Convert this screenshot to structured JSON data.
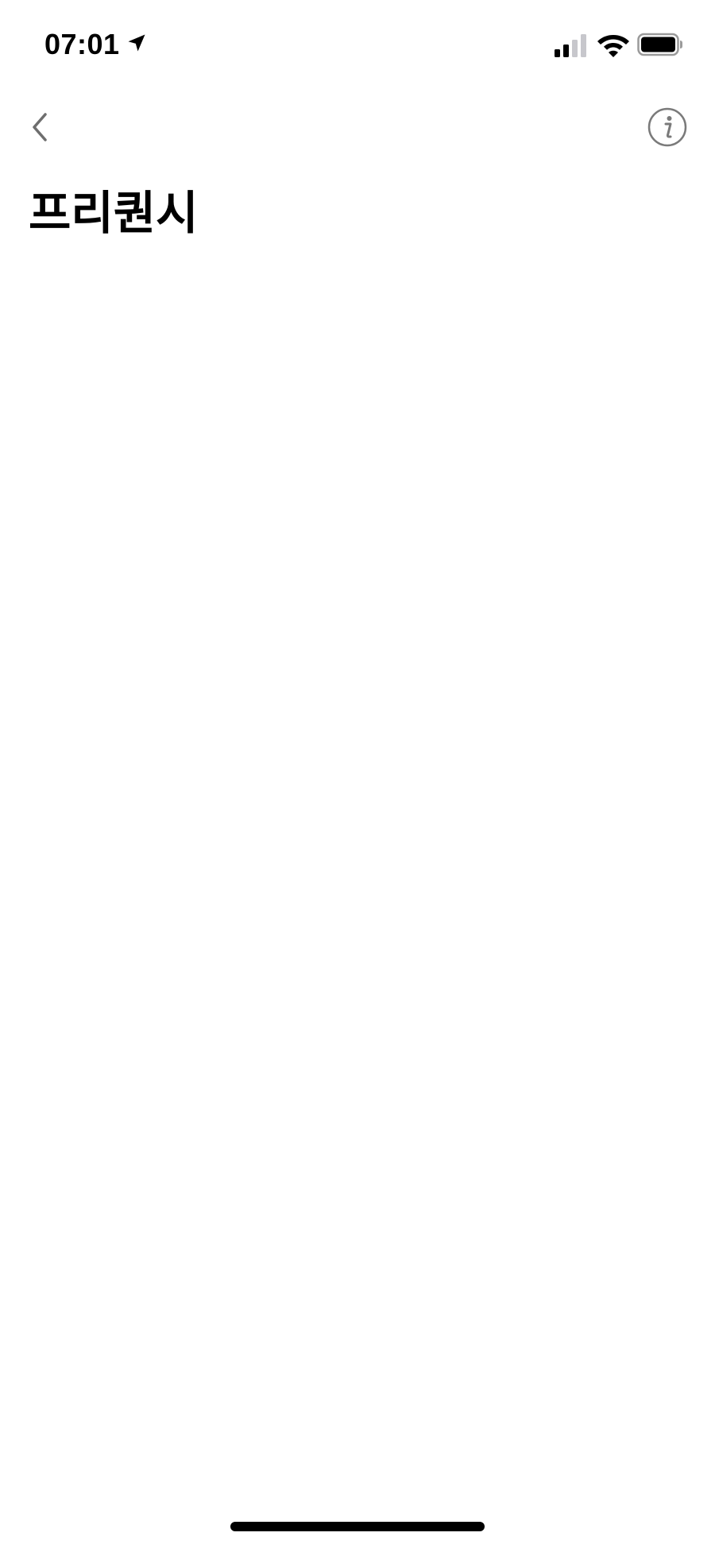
{
  "status_bar": {
    "time": "07:01",
    "location_icon": "location-arrow-icon",
    "signal_icon": "cellular-signal-icon",
    "signal_bars_active": 2,
    "signal_bars_total": 4,
    "wifi_icon": "wifi-icon",
    "battery_icon": "battery-icon",
    "battery_level": 1.0
  },
  "nav": {
    "back_icon": "chevron-left-icon",
    "info_icon": "info-icon"
  },
  "page": {
    "title": "프리퀀시"
  },
  "colors": {
    "background": "#ffffff",
    "text": "#000000",
    "icon_gray": "#7a7a7a",
    "inactive_signal": "#c7c7cc"
  }
}
